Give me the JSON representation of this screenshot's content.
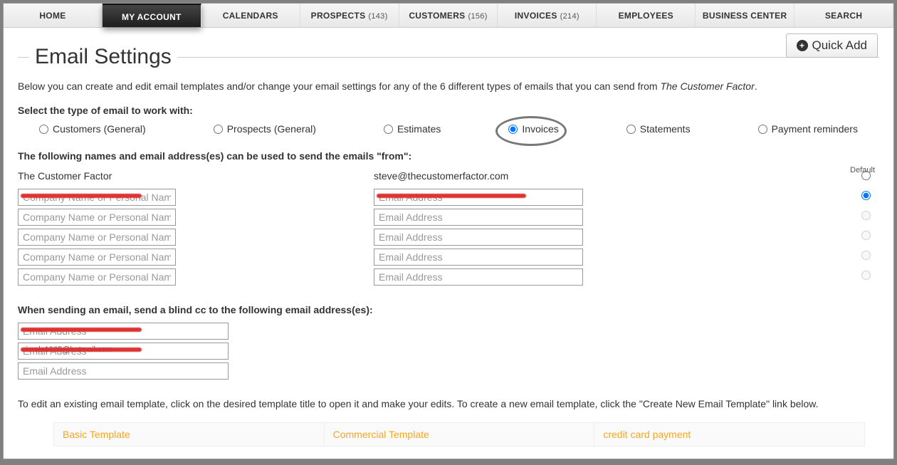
{
  "nav": {
    "items": [
      {
        "label": "HOME",
        "count": ""
      },
      {
        "label": "MY ACCOUNT",
        "count": ""
      },
      {
        "label": "CALENDARS",
        "count": ""
      },
      {
        "label": "PROSPECTS",
        "count": "(143)"
      },
      {
        "label": "CUSTOMERS",
        "count": "(156)"
      },
      {
        "label": "INVOICES",
        "count": "(214)"
      },
      {
        "label": "EMPLOYEES",
        "count": ""
      },
      {
        "label": "BUSINESS CENTER",
        "count": ""
      },
      {
        "label": "SEARCH",
        "count": ""
      }
    ]
  },
  "page": {
    "title": "Email Settings",
    "quick_add": "Quick Add",
    "intro_prefix": "Below you can create and edit email templates and/or change your email settings for any of the 6 different types of emails that you can send from ",
    "intro_brand": "The Customer Factor",
    "intro_suffix": "."
  },
  "select_type": {
    "label": "Select the type of email to work with:",
    "options": [
      "Customers (General)",
      "Prospects (General)",
      "Estimates",
      "Invoices",
      "Statements",
      "Payment reminders"
    ]
  },
  "from": {
    "heading": "The following names and email address(es) can be used to send the emails \"from\":",
    "default_label": "Default",
    "static_name": "The Customer Factor",
    "static_email": "steve@thecustomerfactor.com",
    "rows": [
      {
        "name_val": " ",
        "email_val": " "
      },
      {
        "name_val": "",
        "email_val": ""
      },
      {
        "name_val": "",
        "email_val": ""
      },
      {
        "name_val": "",
        "email_val": ""
      },
      {
        "name_val": "",
        "email_val": ""
      }
    ],
    "name_placeholder": "Company Name or Personal Name",
    "email_placeholder": "Email Address"
  },
  "bcc": {
    "heading": "When sending an email, send a blind cc to the following email address(es):",
    "rows": [
      {
        "val": " ",
        "strike": ""
      },
      {
        "val": " ",
        "strike": "vimala1965@hotmail.com"
      },
      {
        "val": "",
        "strike": ""
      }
    ],
    "placeholder": "Email Address"
  },
  "templates": {
    "note": "To edit an existing email template, click on the desired template title to open it and make your edits. To create a new email template, click the \"Create New Email Template\" link below.",
    "items": [
      "Basic Template",
      "Commercial Template",
      "credit card payment"
    ]
  }
}
